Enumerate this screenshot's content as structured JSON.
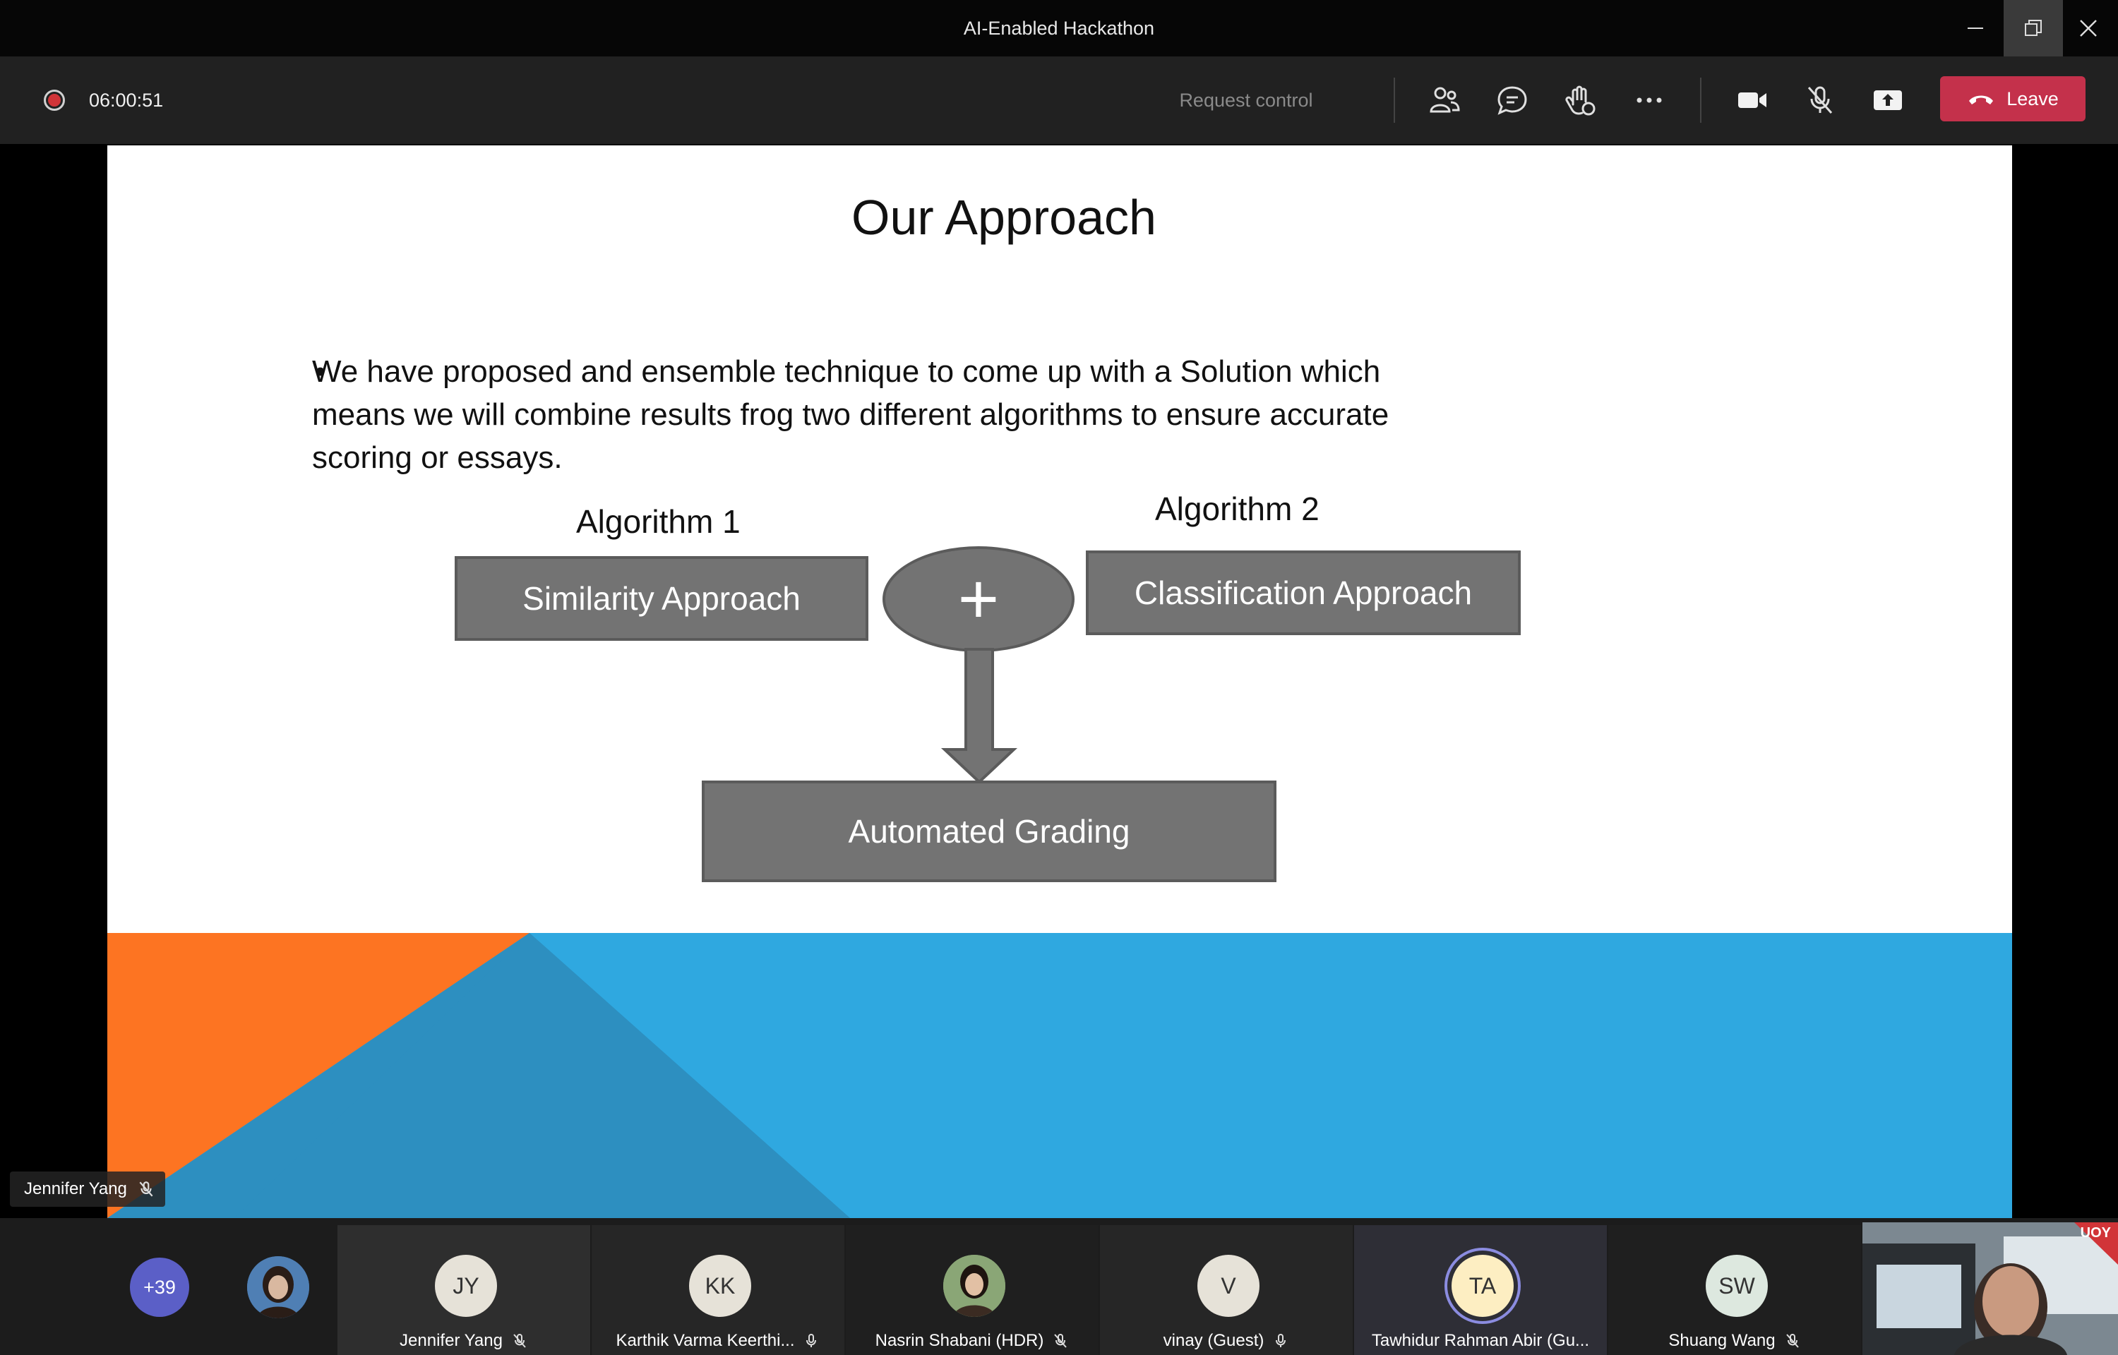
{
  "window": {
    "title": "AI-Enabled Hackathon"
  },
  "toolbar": {
    "timer": "06:00:51",
    "request_control": "Request control",
    "leave_label": "Leave",
    "icons": [
      "people-icon",
      "chat-icon",
      "raise-hand-icon",
      "more-options-icon",
      "camera-icon",
      "mic-muted-icon",
      "share-screen-icon"
    ]
  },
  "slide": {
    "title": "Our Approach",
    "bullet": "We have proposed and ensemble technique to come up with a Solution which means we will combine results frog two different algorithms to ensure accurate scoring or essays.",
    "bullet_symbol": "•",
    "algorithm1_label": "Algorithm 1",
    "algorithm2_label": "Algorithm 2",
    "box1": "Similarity Approach",
    "box2": "Classification Approach",
    "plus": "+",
    "result_box": "Automated Grading",
    "colors": {
      "orange": "#fd7422",
      "blue": "#2fa8e0",
      "dark_blue": "#2d8fc0",
      "box_gray": "#737373"
    }
  },
  "speaker": {
    "name": "Jennifer Yang"
  },
  "participants": {
    "overflow_count": "+39",
    "tiles": [
      {
        "initials": "JY",
        "name": "Jennifer Yang",
        "avatar_color": "#e6e2d8",
        "mic": "muted"
      },
      {
        "initials": "KK",
        "name": "Karthik Varma Keerthi...",
        "avatar_color": "#e6e2d8",
        "mic": "on"
      },
      {
        "initials": "",
        "name": "Nasrin Shabani (HDR)",
        "avatar_color": "#7a9a6a",
        "mic": "muted"
      },
      {
        "initials": "V",
        "name": "vinay (Guest)",
        "avatar_color": "#e6e2d8",
        "mic": "on"
      },
      {
        "initials": "TA",
        "name": "Tawhidur Rahman Abir (Gu...",
        "avatar_color": "#fdeec2",
        "mic": "speaking"
      },
      {
        "initials": "SW",
        "name": "Shuang Wang",
        "avatar_color": "#dde8df",
        "mic": "muted"
      }
    ],
    "video_tile_badge": "UOY"
  }
}
